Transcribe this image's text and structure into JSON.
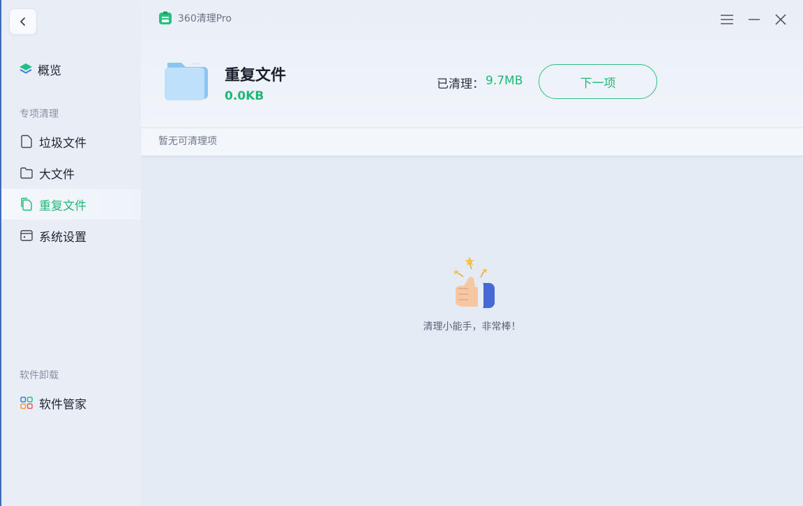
{
  "app": {
    "title": "360清理Pro"
  },
  "sidebar": {
    "overview_label": "概览",
    "section_special": "专项清理",
    "items": [
      {
        "label": "垃圾文件",
        "icon": "file-icon"
      },
      {
        "label": "大文件",
        "icon": "folder-icon"
      },
      {
        "label": "重复文件",
        "icon": "duplicate-file-icon",
        "active": true
      },
      {
        "label": "系统设置",
        "icon": "settings-window-icon"
      }
    ],
    "section_uninstall": "软件卸载",
    "software_manager_label": "软件管家"
  },
  "header": {
    "file_title": "重复文件",
    "file_size": "0.0KB",
    "cleaned_label": "已清理：",
    "cleaned_value": "9.7MB",
    "next_button": "下一项"
  },
  "subbar": {
    "text": "暂无可清理项"
  },
  "empty_state": {
    "message": "清理小能手，非常棒！",
    "icon": "thumbs-up-icon"
  },
  "colors": {
    "accent": "#1fb877",
    "sidebar_bg": "#e9eef6",
    "main_bg": "#e5ebf5"
  }
}
